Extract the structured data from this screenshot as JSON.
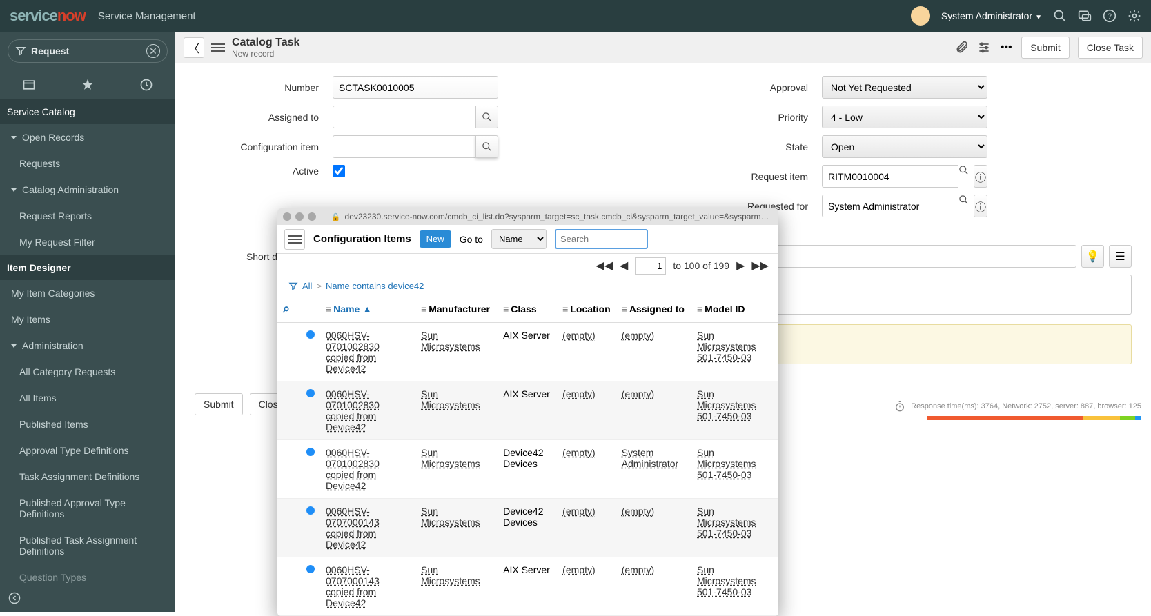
{
  "brand": {
    "part1": "service",
    "part2": "now",
    "product": "Service Management"
  },
  "user": {
    "name": "System Administrator"
  },
  "sidebar": {
    "filter_label": "Request",
    "section1": "Service Catalog",
    "group_open": "Open Records",
    "items_open": [
      "Requests"
    ],
    "group_catalog": "Catalog Administration",
    "items_catalog": [
      "Request Reports",
      "My Request Filter"
    ],
    "section2": "Item Designer",
    "items_designer": [
      "My Item Categories",
      "My Items"
    ],
    "group_admin": "Administration",
    "items_admin": [
      "All Category Requests",
      "All Items",
      "Published Items",
      "Approval Type Definitions",
      "Task Assignment Definitions",
      "Published Approval Type Definitions",
      "Published Task Assignment Definitions",
      "Question Types"
    ]
  },
  "header": {
    "title": "Catalog Task",
    "subtitle": "New record",
    "submit": "Submit",
    "close": "Close Task"
  },
  "form": {
    "number": {
      "label": "Number",
      "value": "SCTASK0010005"
    },
    "assigned_to": {
      "label": "Assigned to",
      "value": ""
    },
    "config_item": {
      "label": "Configuration item",
      "value": ""
    },
    "active": {
      "label": "Active",
      "checked": true
    },
    "approval": {
      "label": "Approval",
      "value": "Not Yet Requested"
    },
    "priority": {
      "label": "Priority",
      "value": "4 - Low"
    },
    "state": {
      "label": "State",
      "value": "Open"
    },
    "request_item": {
      "label": "Request item",
      "value": "RITM0010004"
    },
    "requested_for": {
      "label": "Requested for",
      "value": "System Administrator"
    },
    "short_desc": {
      "label": "Short description",
      "value": ""
    },
    "btn_submit": "Submit",
    "btn_close": "Close Task"
  },
  "popup": {
    "url": "dev23230.service-now.com/cmdb_ci_list.do?sysparm_target=sc_task.cmdb_ci&sysparm_target_value=&sysparm_r...",
    "title": "Configuration Items",
    "new_btn": "New",
    "goto": "Go to",
    "goto_field": "Name",
    "search_placeholder": "Search",
    "page": "1",
    "range": "to 100 of 199",
    "breadcrumb": {
      "all": "All",
      "filter": "Name contains device42"
    },
    "cols": [
      "Name",
      "Manufacturer",
      "Class",
      "Location",
      "Assigned to",
      "Model ID"
    ],
    "rows": [
      {
        "name": "0060HSV-0701002830 copied from Device42",
        "mfr": "Sun Microsystems",
        "cls": "AIX Server",
        "loc": "(empty)",
        "asg": "(empty)",
        "model": "Sun Microsystems 501-7450-03"
      },
      {
        "name": "0060HSV-0701002830 copied from Device42",
        "mfr": "Sun Microsystems",
        "cls": "AIX Server",
        "loc": "(empty)",
        "asg": "(empty)",
        "model": "Sun Microsystems 501-7450-03"
      },
      {
        "name": "0060HSV-0701002830 copied from Device42",
        "mfr": "Sun Microsystems",
        "cls": "Device42 Devices",
        "loc": "(empty)",
        "asg": "System Administrator",
        "model": "Sun Microsystems 501-7450-03"
      },
      {
        "name": "0060HSV-0707000143 copied from Device42",
        "mfr": "Sun Microsystems",
        "cls": "Device42 Devices",
        "loc": "(empty)",
        "asg": "(empty)",
        "model": "Sun Microsystems 501-7450-03"
      },
      {
        "name": "0060HSV-0707000143 copied from Device42",
        "mfr": "Sun Microsystems",
        "cls": "AIX Server",
        "loc": "(empty)",
        "asg": "(empty)",
        "model": "Sun Microsystems 501-7450-03"
      }
    ]
  },
  "response": "Response time(ms): 3764, Network: 2752, server: 887, browser: 125"
}
